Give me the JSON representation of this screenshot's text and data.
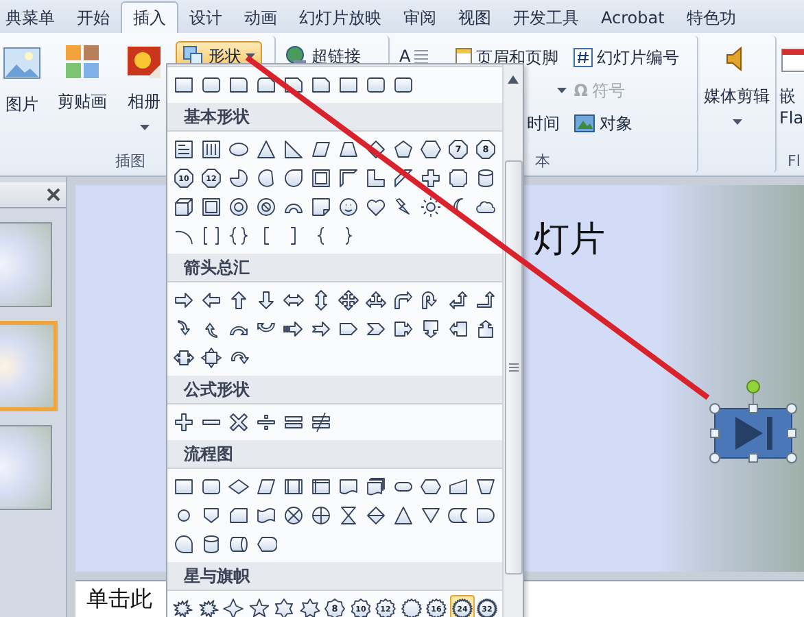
{
  "ribbon_tabs": [
    {
      "label": "典菜单",
      "selected": false
    },
    {
      "label": "开始",
      "selected": false
    },
    {
      "label": "插入",
      "selected": true
    },
    {
      "label": "设计",
      "selected": false
    },
    {
      "label": "动画",
      "selected": false
    },
    {
      "label": "幻灯片放映",
      "selected": false
    },
    {
      "label": "审阅",
      "selected": false
    },
    {
      "label": "视图",
      "selected": false
    },
    {
      "label": "开发工具",
      "selected": false
    },
    {
      "label": "Acrobat",
      "selected": false
    },
    {
      "label": "特色功",
      "selected": false
    }
  ],
  "illustrations_group": {
    "title": "插图",
    "picture_button": "图片",
    "clipart_button": "剪贴画",
    "album_button": "相册",
    "shapes_button": {
      "label": "形状",
      "expanded": true
    }
  },
  "links_group": {
    "hyperlink_button": "超链接"
  },
  "text_group": {
    "title": "本",
    "textbox_glyph": "A",
    "header_footer_button": "页眉和页脚",
    "slide_number_button": "幻灯片编号",
    "symbol_button": {
      "glyph": "Ω",
      "label": "符号",
      "disabled": true
    },
    "datetime_button": "时间",
    "object_button": "对象"
  },
  "media_group": {
    "media_button": "媒体剪辑"
  },
  "flash_group": {
    "title": "Fl",
    "embed_button": "嵌",
    "embed_button_line2": "Fla"
  },
  "slides_panel": {
    "thumbnails": [
      {
        "selected": false
      },
      {
        "selected": true
      },
      {
        "selected": false
      }
    ]
  },
  "slide": {
    "title_fragment": "灯片"
  },
  "notes": {
    "text": "单击此"
  },
  "shapes_menu": {
    "sections": [
      {
        "shapes": [
          {
            "kind": "rect"
          },
          {
            "kind": "roundrect"
          },
          {
            "kind": "roundcorner"
          },
          {
            "kind": "roundsnip"
          },
          {
            "kind": "snip"
          },
          {
            "kind": "snip"
          },
          {
            "kind": "rect"
          },
          {
            "kind": "roundrect"
          },
          {
            "kind": "roundrect"
          }
        ]
      },
      {
        "title": "基本形状",
        "shapes": [
          {
            "kind": "textbox"
          },
          {
            "kind": "vtextbox"
          },
          {
            "kind": "ellipse"
          },
          {
            "kind": "triangle"
          },
          {
            "kind": "rtriangle"
          },
          {
            "kind": "parallelogram"
          },
          {
            "kind": "trapezoid"
          },
          {
            "kind": "diamond"
          },
          {
            "kind": "pentagon"
          },
          {
            "kind": "hexagon"
          },
          {
            "kind": "octagon",
            "label": "7"
          },
          {
            "kind": "octagon",
            "label": "8"
          },
          {
            "kind": "octagon",
            "label": "10"
          },
          {
            "kind": "octagon",
            "label": "12"
          },
          {
            "kind": "pie"
          },
          {
            "kind": "chord"
          },
          {
            "kind": "teardrop"
          },
          {
            "kind": "frame"
          },
          {
            "kind": "halfframe"
          },
          {
            "kind": "lshape"
          },
          {
            "kind": "diagstripe"
          },
          {
            "kind": "cross"
          },
          {
            "kind": "plaque"
          },
          {
            "kind": "can"
          },
          {
            "kind": "cube"
          },
          {
            "kind": "bevel"
          },
          {
            "kind": "donut"
          },
          {
            "kind": "noentry"
          },
          {
            "kind": "arc"
          },
          {
            "kind": "foldedcorner"
          },
          {
            "kind": "smiley"
          },
          {
            "kind": "heart"
          },
          {
            "kind": "lightning"
          },
          {
            "kind": "sun"
          },
          {
            "kind": "moon"
          },
          {
            "kind": "cloud"
          },
          {
            "kind": "arcline"
          },
          {
            "kind": "bracketpair"
          },
          {
            "kind": "bracepair"
          },
          {
            "kind": "leftbracket"
          },
          {
            "kind": "rightbracket"
          },
          {
            "kind": "leftbrace"
          },
          {
            "kind": "rightbrace"
          }
        ]
      },
      {
        "title": "箭头总汇",
        "shapes": [
          {
            "kind": "right"
          },
          {
            "kind": "left"
          },
          {
            "kind": "up"
          },
          {
            "kind": "down"
          },
          {
            "kind": "leftright"
          },
          {
            "kind": "updown"
          },
          {
            "kind": "quad"
          },
          {
            "kind": "leftrightup"
          },
          {
            "kind": "bent"
          },
          {
            "kind": "uturn"
          },
          {
            "kind": "leftup"
          },
          {
            "kind": "bentup"
          },
          {
            "kind": "curvedright"
          },
          {
            "kind": "curvedleft"
          },
          {
            "kind": "curvedup"
          },
          {
            "kind": "curveddown"
          },
          {
            "kind": "striped"
          },
          {
            "kind": "notched"
          },
          {
            "kind": "pentagonarrow"
          },
          {
            "kind": "chevron"
          },
          {
            "kind": "rightcallout"
          },
          {
            "kind": "downcallout"
          },
          {
            "kind": "leftcallout"
          },
          {
            "kind": "upcallout"
          },
          {
            "kind": "leftrightcallout"
          },
          {
            "kind": "quadcallout"
          },
          {
            "kind": "circular"
          }
        ]
      },
      {
        "title": "公式形状",
        "shapes": [
          {
            "kind": "plus"
          },
          {
            "kind": "minus"
          },
          {
            "kind": "multiply"
          },
          {
            "kind": "divide"
          },
          {
            "kind": "equal"
          },
          {
            "kind": "notequal"
          }
        ]
      },
      {
        "title": "流程图",
        "shapes": [
          {
            "kind": "rect"
          },
          {
            "kind": "roundrect"
          },
          {
            "kind": "decision"
          },
          {
            "kind": "parallelogram"
          },
          {
            "kind": "predefined"
          },
          {
            "kind": "internal"
          },
          {
            "kind": "document"
          },
          {
            "kind": "multidoc"
          },
          {
            "kind": "terminator"
          },
          {
            "kind": "preparation"
          },
          {
            "kind": "manualinput"
          },
          {
            "kind": "manualop"
          },
          {
            "kind": "connector"
          },
          {
            "kind": "offpage"
          },
          {
            "kind": "card"
          },
          {
            "kind": "punchedtape"
          },
          {
            "kind": "summing"
          },
          {
            "kind": "or"
          },
          {
            "kind": "collate"
          },
          {
            "kind": "sort"
          },
          {
            "kind": "triangle"
          },
          {
            "kind": "merge"
          },
          {
            "kind": "storeddata"
          },
          {
            "kind": "delay"
          },
          {
            "kind": "seqaccess"
          },
          {
            "kind": "can"
          },
          {
            "kind": "directaccess"
          },
          {
            "kind": "display"
          }
        ]
      },
      {
        "title": "星与旗帜",
        "shapes": [
          {
            "kind": "explosion",
            "selected": false
          },
          {
            "kind": "explosion",
            "selected": false
          },
          {
            "kind": "star4",
            "selected": false
          },
          {
            "kind": "star5",
            "selected": false
          },
          {
            "kind": "star6",
            "selected": false
          },
          {
            "kind": "star7",
            "selected": false
          },
          {
            "kind": "star8",
            "label": "8",
            "selected": false
          },
          {
            "kind": "star10",
            "label": "10",
            "selected": false
          },
          {
            "kind": "star12",
            "label": "12",
            "selected": false
          },
          {
            "kind": "star16",
            "selected": false
          },
          {
            "kind": "star16",
            "label": "16",
            "selected": false
          },
          {
            "kind": "star24",
            "label": "24",
            "selected": true
          },
          {
            "kind": "star32",
            "label": "32",
            "selected": false
          }
        ]
      }
    ]
  }
}
